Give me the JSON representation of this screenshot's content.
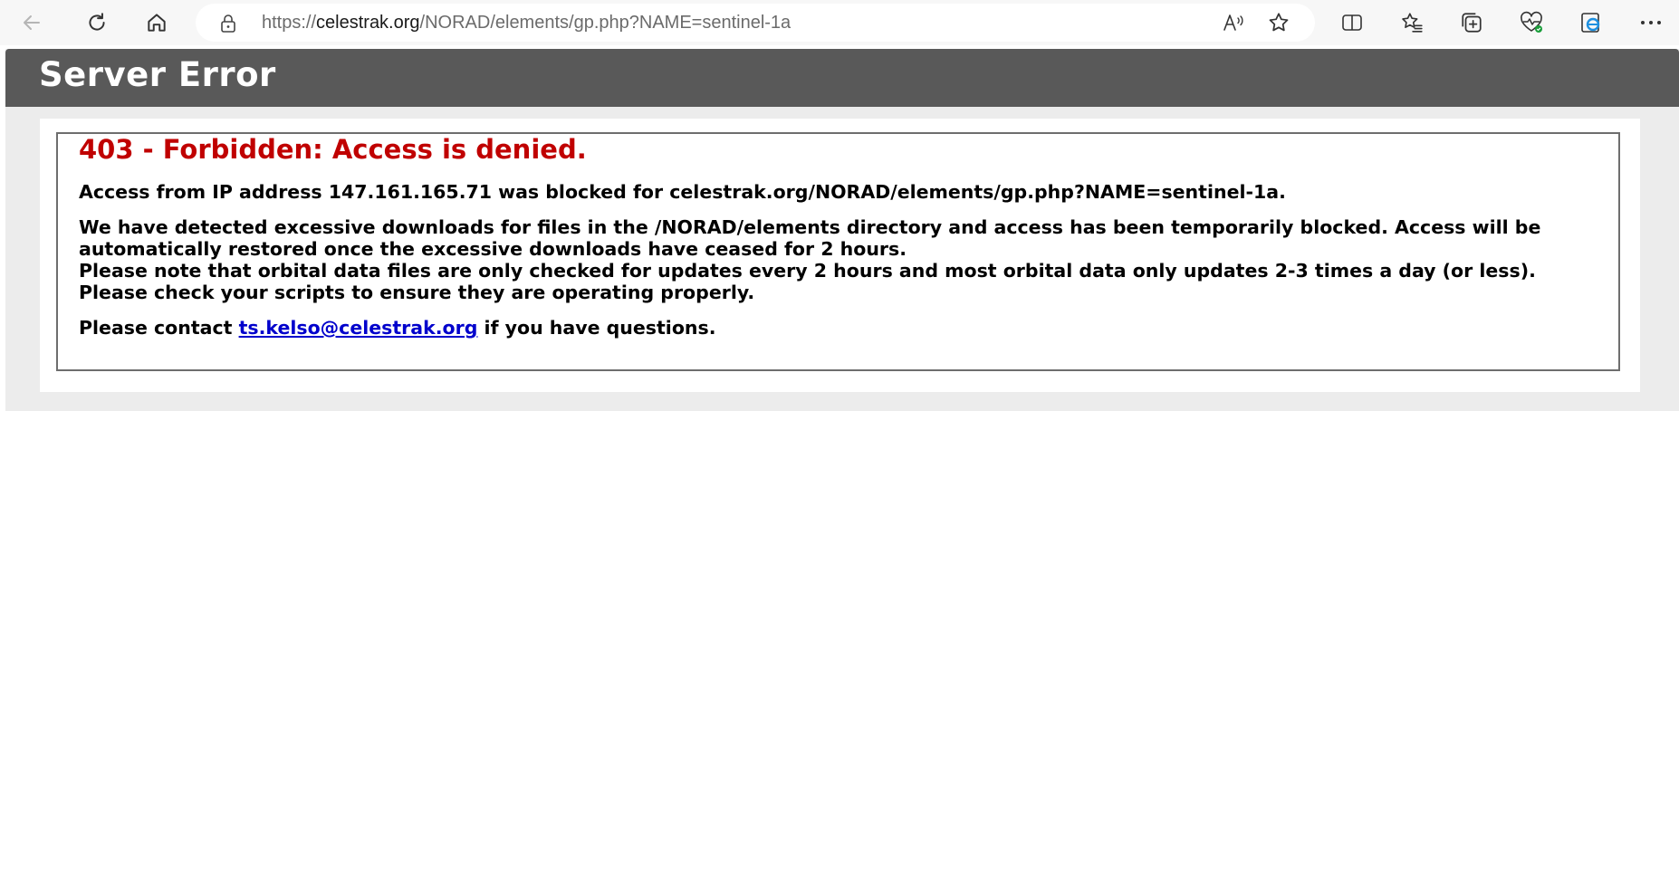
{
  "browser": {
    "url_prefix": "https://",
    "url_host": "celestrak.org",
    "url_path": "/NORAD/elements/gp.php?NAME=sentinel-1a"
  },
  "page": {
    "header_title": "Server Error",
    "error_title": "403 - Forbidden: Access is denied.",
    "blocked_message": "Access from IP address 147.161.165.71 was blocked for celestrak.org/NORAD/elements/gp.php?NAME=sentinel-1a.",
    "excessive_message": "We have detected excessive downloads for files in the /NORAD/elements directory and access has been temporarily blocked. Access will be automatically restored once the excessive downloads have ceased for 2 hours.",
    "update_note": "Please note that orbital data files are only checked for updates every 2 hours and most orbital data only updates 2-3 times a day (or less). Please check your scripts to ensure they are operating properly.",
    "contact_prefix": "Please contact ",
    "contact_email": "ts.kelso@celestrak.org",
    "contact_suffix": " if you have questions."
  },
  "colors": {
    "header_bg": "#595959",
    "error_red": "#c00000",
    "link_blue": "#0000cc",
    "page_bg": "#ececec"
  },
  "icons": {
    "back": "back-arrow-icon",
    "refresh": "refresh-icon",
    "home": "home-icon",
    "lock": "lock-icon",
    "read_aloud": "read-aloud-icon",
    "favorite": "star-icon",
    "split_screen": "split-screen-icon",
    "favorites": "favorites-list-icon",
    "collections": "collections-icon",
    "browser_essentials": "heart-pulse-icon",
    "ie_mode": "ie-mode-icon",
    "more": "more-dots-icon"
  }
}
